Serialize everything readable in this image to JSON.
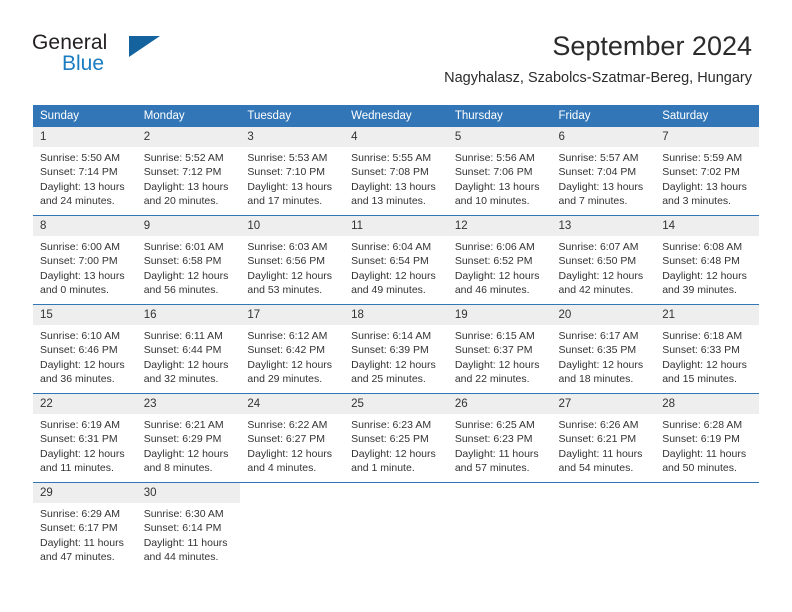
{
  "brand": {
    "name_top": "General",
    "name_bottom": "Blue",
    "flag_color": "#14639e",
    "blue_color": "#1b7dc1"
  },
  "header": {
    "title": "September 2024",
    "subtitle": "Nagyhalasz, Szabolcs-Szatmar-Bereg, Hungary"
  },
  "theme": {
    "header_blue": "#3276b8",
    "daynum_bg": "#eeeeee",
    "text": "#333333"
  },
  "calendar": {
    "weekday_headers": [
      "Sunday",
      "Monday",
      "Tuesday",
      "Wednesday",
      "Thursday",
      "Friday",
      "Saturday"
    ],
    "weeks": [
      [
        {
          "day": "1",
          "sunrise": "Sunrise: 5:50 AM",
          "sunset": "Sunset: 7:14 PM",
          "daylight_line1": "Daylight: 13 hours",
          "daylight_line2": "and 24 minutes."
        },
        {
          "day": "2",
          "sunrise": "Sunrise: 5:52 AM",
          "sunset": "Sunset: 7:12 PM",
          "daylight_line1": "Daylight: 13 hours",
          "daylight_line2": "and 20 minutes."
        },
        {
          "day": "3",
          "sunrise": "Sunrise: 5:53 AM",
          "sunset": "Sunset: 7:10 PM",
          "daylight_line1": "Daylight: 13 hours",
          "daylight_line2": "and 17 minutes."
        },
        {
          "day": "4",
          "sunrise": "Sunrise: 5:55 AM",
          "sunset": "Sunset: 7:08 PM",
          "daylight_line1": "Daylight: 13 hours",
          "daylight_line2": "and 13 minutes."
        },
        {
          "day": "5",
          "sunrise": "Sunrise: 5:56 AM",
          "sunset": "Sunset: 7:06 PM",
          "daylight_line1": "Daylight: 13 hours",
          "daylight_line2": "and 10 minutes."
        },
        {
          "day": "6",
          "sunrise": "Sunrise: 5:57 AM",
          "sunset": "Sunset: 7:04 PM",
          "daylight_line1": "Daylight: 13 hours",
          "daylight_line2": "and 7 minutes."
        },
        {
          "day": "7",
          "sunrise": "Sunrise: 5:59 AM",
          "sunset": "Sunset: 7:02 PM",
          "daylight_line1": "Daylight: 13 hours",
          "daylight_line2": "and 3 minutes."
        }
      ],
      [
        {
          "day": "8",
          "sunrise": "Sunrise: 6:00 AM",
          "sunset": "Sunset: 7:00 PM",
          "daylight_line1": "Daylight: 13 hours",
          "daylight_line2": "and 0 minutes."
        },
        {
          "day": "9",
          "sunrise": "Sunrise: 6:01 AM",
          "sunset": "Sunset: 6:58 PM",
          "daylight_line1": "Daylight: 12 hours",
          "daylight_line2": "and 56 minutes."
        },
        {
          "day": "10",
          "sunrise": "Sunrise: 6:03 AM",
          "sunset": "Sunset: 6:56 PM",
          "daylight_line1": "Daylight: 12 hours",
          "daylight_line2": "and 53 minutes."
        },
        {
          "day": "11",
          "sunrise": "Sunrise: 6:04 AM",
          "sunset": "Sunset: 6:54 PM",
          "daylight_line1": "Daylight: 12 hours",
          "daylight_line2": "and 49 minutes."
        },
        {
          "day": "12",
          "sunrise": "Sunrise: 6:06 AM",
          "sunset": "Sunset: 6:52 PM",
          "daylight_line1": "Daylight: 12 hours",
          "daylight_line2": "and 46 minutes."
        },
        {
          "day": "13",
          "sunrise": "Sunrise: 6:07 AM",
          "sunset": "Sunset: 6:50 PM",
          "daylight_line1": "Daylight: 12 hours",
          "daylight_line2": "and 42 minutes."
        },
        {
          "day": "14",
          "sunrise": "Sunrise: 6:08 AM",
          "sunset": "Sunset: 6:48 PM",
          "daylight_line1": "Daylight: 12 hours",
          "daylight_line2": "and 39 minutes."
        }
      ],
      [
        {
          "day": "15",
          "sunrise": "Sunrise: 6:10 AM",
          "sunset": "Sunset: 6:46 PM",
          "daylight_line1": "Daylight: 12 hours",
          "daylight_line2": "and 36 minutes."
        },
        {
          "day": "16",
          "sunrise": "Sunrise: 6:11 AM",
          "sunset": "Sunset: 6:44 PM",
          "daylight_line1": "Daylight: 12 hours",
          "daylight_line2": "and 32 minutes."
        },
        {
          "day": "17",
          "sunrise": "Sunrise: 6:12 AM",
          "sunset": "Sunset: 6:42 PM",
          "daylight_line1": "Daylight: 12 hours",
          "daylight_line2": "and 29 minutes."
        },
        {
          "day": "18",
          "sunrise": "Sunrise: 6:14 AM",
          "sunset": "Sunset: 6:39 PM",
          "daylight_line1": "Daylight: 12 hours",
          "daylight_line2": "and 25 minutes."
        },
        {
          "day": "19",
          "sunrise": "Sunrise: 6:15 AM",
          "sunset": "Sunset: 6:37 PM",
          "daylight_line1": "Daylight: 12 hours",
          "daylight_line2": "and 22 minutes."
        },
        {
          "day": "20",
          "sunrise": "Sunrise: 6:17 AM",
          "sunset": "Sunset: 6:35 PM",
          "daylight_line1": "Daylight: 12 hours",
          "daylight_line2": "and 18 minutes."
        },
        {
          "day": "21",
          "sunrise": "Sunrise: 6:18 AM",
          "sunset": "Sunset: 6:33 PM",
          "daylight_line1": "Daylight: 12 hours",
          "daylight_line2": "and 15 minutes."
        }
      ],
      [
        {
          "day": "22",
          "sunrise": "Sunrise: 6:19 AM",
          "sunset": "Sunset: 6:31 PM",
          "daylight_line1": "Daylight: 12 hours",
          "daylight_line2": "and 11 minutes."
        },
        {
          "day": "23",
          "sunrise": "Sunrise: 6:21 AM",
          "sunset": "Sunset: 6:29 PM",
          "daylight_line1": "Daylight: 12 hours",
          "daylight_line2": "and 8 minutes."
        },
        {
          "day": "24",
          "sunrise": "Sunrise: 6:22 AM",
          "sunset": "Sunset: 6:27 PM",
          "daylight_line1": "Daylight: 12 hours",
          "daylight_line2": "and 4 minutes."
        },
        {
          "day": "25",
          "sunrise": "Sunrise: 6:23 AM",
          "sunset": "Sunset: 6:25 PM",
          "daylight_line1": "Daylight: 12 hours",
          "daylight_line2": "and 1 minute."
        },
        {
          "day": "26",
          "sunrise": "Sunrise: 6:25 AM",
          "sunset": "Sunset: 6:23 PM",
          "daylight_line1": "Daylight: 11 hours",
          "daylight_line2": "and 57 minutes."
        },
        {
          "day": "27",
          "sunrise": "Sunrise: 6:26 AM",
          "sunset": "Sunset: 6:21 PM",
          "daylight_line1": "Daylight: 11 hours",
          "daylight_line2": "and 54 minutes."
        },
        {
          "day": "28",
          "sunrise": "Sunrise: 6:28 AM",
          "sunset": "Sunset: 6:19 PM",
          "daylight_line1": "Daylight: 11 hours",
          "daylight_line2": "and 50 minutes."
        }
      ],
      [
        {
          "day": "29",
          "sunrise": "Sunrise: 6:29 AM",
          "sunset": "Sunset: 6:17 PM",
          "daylight_line1": "Daylight: 11 hours",
          "daylight_line2": "and 47 minutes."
        },
        {
          "day": "30",
          "sunrise": "Sunrise: 6:30 AM",
          "sunset": "Sunset: 6:14 PM",
          "daylight_line1": "Daylight: 11 hours",
          "daylight_line2": "and 44 minutes."
        },
        null,
        null,
        null,
        null,
        null
      ]
    ]
  }
}
